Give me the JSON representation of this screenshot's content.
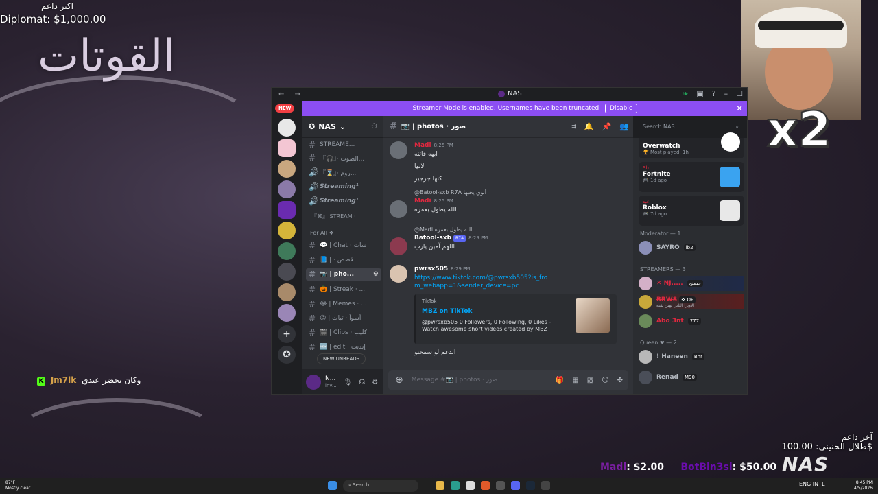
{
  "stream": {
    "top_label": "اكبر داعم",
    "top_value": "Diplomat: $1,000.00",
    "big_arabic": "القوتات",
    "cam_multiplier": "x2",
    "chat": {
      "badge": "K",
      "user": "Jm7lk",
      "text": "وكان يحضر عندي"
    },
    "last_donor_label": "آخر داعم",
    "last_donor_value": "طلال الحنيني: 100.00$",
    "tips": [
      {
        "name": "Madi",
        "amount": ": $2.00"
      },
      {
        "name": "BotBin3sl",
        "amount": ": $50.00"
      }
    ],
    "logo": "NAS"
  },
  "window": {
    "nav": "← →",
    "title": "NAS",
    "controls": [
      "leaf-icon",
      "inbox-icon",
      "help-icon",
      "minimize-icon",
      "maximize-icon"
    ],
    "banner_text": "Streamer Mode is enabled. Usernames have been truncated.",
    "banner_button": "Disable",
    "banner_close": "✕"
  },
  "guilds": {
    "new_badge": "NEW"
  },
  "sidebar": {
    "server_name": "NAS",
    "channels": [
      {
        "icon": "#",
        "label": "STREAME..."
      },
      {
        "icon": "#",
        "label": "『🎧』· الصوت..."
      },
      {
        "icon": "🔊",
        "label": "『⌛』· روم..."
      },
      {
        "icon": "🔊",
        "label": "Streaming¹"
      },
      {
        "icon": "🔊",
        "label": "Streaming¹"
      }
    ],
    "cat_stream": "『⌘』 STREAM ·",
    "cat_forall": "For All ❖",
    "channels2": [
      {
        "icon": "#",
        "label": "💬 | Chat · شات"
      },
      {
        "icon": "#",
        "label": "📘 | · قصص"
      },
      {
        "icon": "#",
        "label": "📷 | pho..."
      },
      {
        "icon": "#",
        "label": "🎃 | Streak · ..."
      },
      {
        "icon": "#",
        "label": "😂 | Memes · ..."
      },
      {
        "icon": "#",
        "label": "😝 | أسوأ · ثبات"
      },
      {
        "icon": "#",
        "label": "🎬 | Clips · كليب"
      },
      {
        "icon": "#",
        "label": "🆕 | edit · إيديت"
      }
    ],
    "new_unreads": "NEW UNREADS",
    "user_name": "N...",
    "user_status": "inv..."
  },
  "channel": {
    "title": "📷 | photos · صور",
    "search_placeholder": "Search NAS",
    "composer_placeholder": "Message #📷 | photos · صور"
  },
  "messages": [
    {
      "author": "Madi",
      "time": "8:25 PM",
      "lines": [
        "ايهه فاتنه",
        "لانها",
        "كنها جرجير"
      ]
    },
    {
      "reply": "@Batool-sxb R7A أبوي يحبها",
      "author": "Madi",
      "time": "8:25 PM",
      "lines": [
        "الله يطول بعمره"
      ]
    },
    {
      "reply": "@Madi الله يطول بعمره",
      "author": "Batool-sxb",
      "tag": "R7A",
      "time": "8:29 PM",
      "lines": [
        "اللهم آمين يارب"
      ]
    },
    {
      "author": "pwrsx505",
      "time": "8:29 PM",
      "link": "https://www.tiktok.com/@pwrsxb505?is_from_webapp=1&sender_device=pc",
      "embed": {
        "provider": "TikTok",
        "title": "MBZ on TikTok",
        "desc": "@pwrsxb505 0 Followers, 0 Following, 0 Likes - Watch awesome short videos created by MBZ"
      },
      "after": "الدعم لو سمحتو"
    }
  ],
  "members": {
    "activities": [
      {
        "game": "Overwatch",
        "sub": "🏆 Most played: 1h"
      },
      {
        "user": "Sh. ..",
        "game": "Fortnite",
        "sub": "🎮 1d ago"
      },
      {
        "user": "عبد",
        "game": "Roblox",
        "sub": "🎮 7d ago"
      }
    ],
    "mod_header": "Moderator — 1",
    "mod": [
      {
        "name": "SAYRO",
        "badge": "lb2"
      }
    ],
    "streamers_header": "STREAMERS — 3",
    "streamers": [
      {
        "name": "✕ NJ.....",
        "badge": "جيمنج"
      },
      {
        "name": "B̶R̶W̶S̶",
        "badge": "✜ OP",
        "sub": "الاوبرا الثاني بهبن شيه"
      },
      {
        "name": "Abo 3nt",
        "badge": "777"
      }
    ],
    "queen_header": "Queen ❤ — 2",
    "queen": [
      {
        "name": "! Haneen",
        "badge": "Bnr"
      },
      {
        "name": "Renad",
        "badge": "M90"
      }
    ]
  },
  "taskbar": {
    "weather_temp": "87°F",
    "weather_text": "Mostly clear",
    "search": "Search",
    "lang": "ENG",
    "lang2": "INTL",
    "time": "8:45 PM",
    "date": "4/5/2026"
  }
}
